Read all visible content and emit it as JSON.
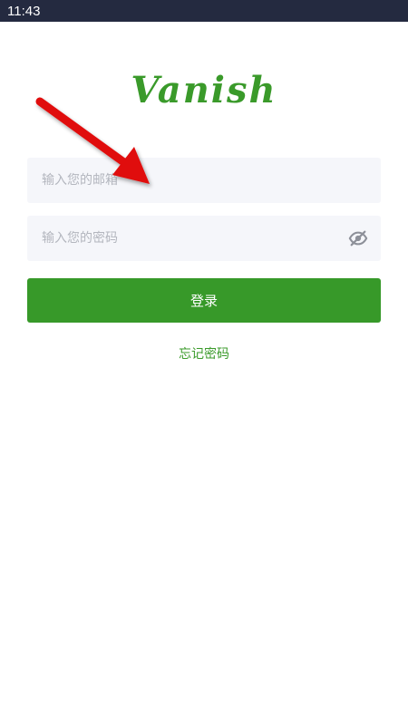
{
  "status_bar": {
    "time": "11:43"
  },
  "app": {
    "logo_text": "Vanish"
  },
  "login_form": {
    "email_placeholder": "输入您的邮箱",
    "email_value": "",
    "password_placeholder": "输入您的密码",
    "password_value": "",
    "password_toggle_icon": "eye-slash-icon",
    "login_label": "登录",
    "forgot_password_label": "忘记密码"
  },
  "colors": {
    "brand_green": "#379929",
    "status_bar_bg": "#242a40",
    "input_bg": "#f5f6fa",
    "annotation_arrow": "#e01010"
  }
}
